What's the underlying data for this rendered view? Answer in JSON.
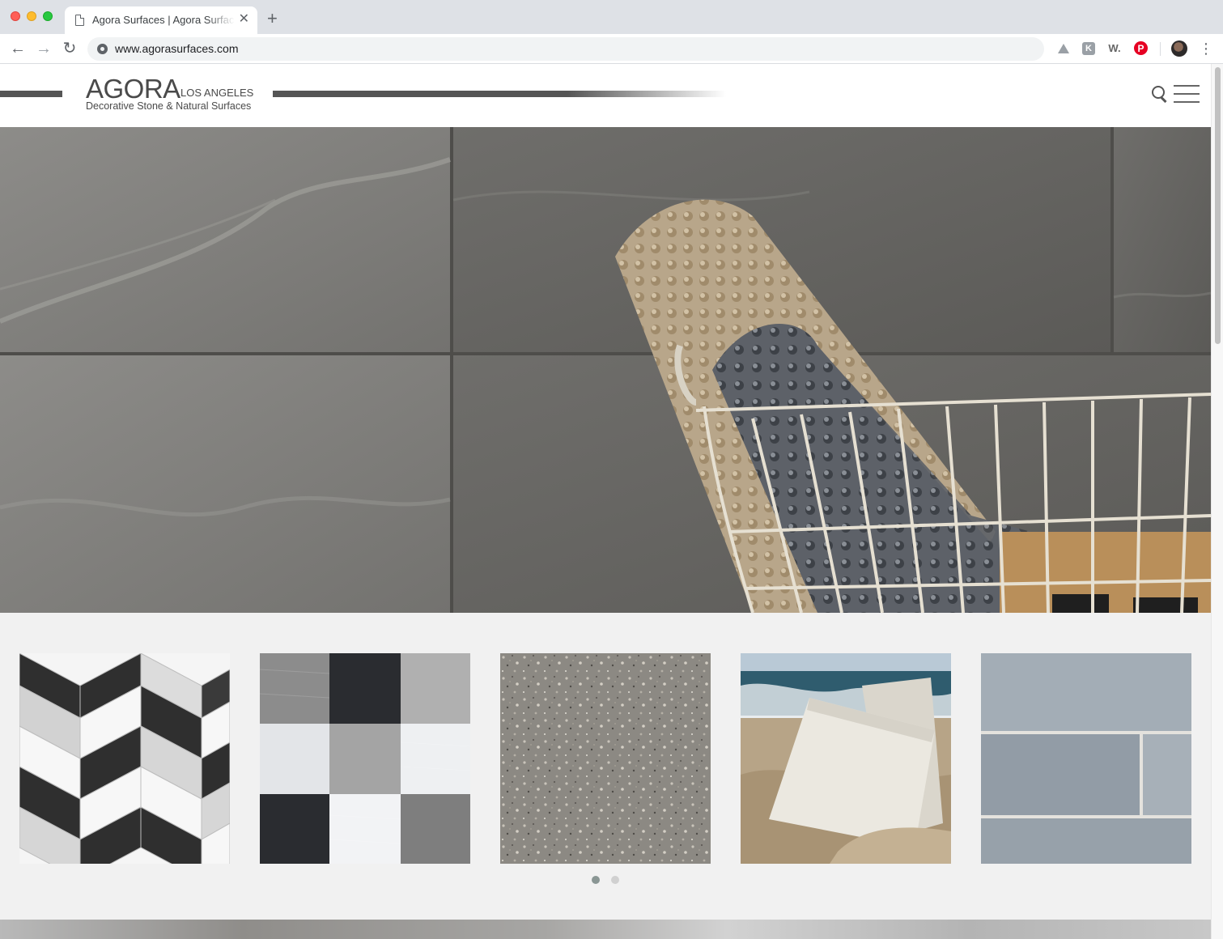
{
  "browser": {
    "tab_title": "Agora Surfaces | Agora Surfaces",
    "tab_close": "✕",
    "new_tab": "+",
    "url": "www.agorasurfaces.com",
    "nav": {
      "back": "←",
      "forward": "→",
      "reload": "↻"
    },
    "extensions": [
      {
        "name": "drive-icon",
        "label": ""
      },
      {
        "name": "k-icon",
        "label": "K"
      },
      {
        "name": "w-icon",
        "label": "W."
      },
      {
        "name": "pinterest-icon",
        "label": "P"
      }
    ],
    "menu": "⋮"
  },
  "site": {
    "logo_main": "AGORA",
    "logo_city": "LOS ANGELES",
    "logo_tagline": "Decorative Stone & Natural Surfaces"
  },
  "hero": {
    "image": "stone-tile-wall-with-wire-basket-and-rugs"
  },
  "products": [
    {
      "name": "chevron-tile",
      "image": "black-grey-white-chevron-mosaic"
    },
    {
      "name": "checker-tile",
      "image": "grey-black-white-textured-squares"
    },
    {
      "name": "terrazzo-tile",
      "image": "grey-terrazzo-speckled-surface"
    },
    {
      "name": "beach-quartz",
      "image": "white-quartz-slabs-on-beach"
    },
    {
      "name": "subway-tile",
      "image": "light-blue-grey-subway-tile"
    }
  ],
  "carousel": {
    "pages": 2,
    "active": 1
  },
  "colors": {
    "header_bar": "#555555",
    "page_bg": "#f1f1f1",
    "dot_active": "#8a9694",
    "dot_inactive": "#d0d0d0"
  }
}
